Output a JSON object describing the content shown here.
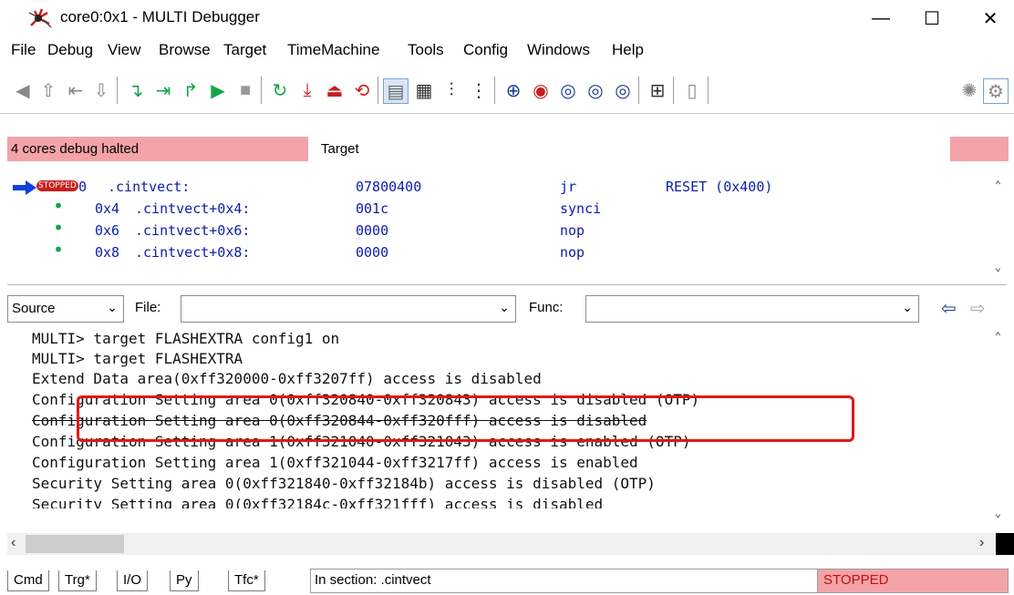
{
  "window": {
    "title": "core0:0x1 - MULTI Debugger",
    "minimize": "—",
    "maximize": "☐",
    "close": "✕"
  },
  "menu": [
    "File",
    "Debug",
    "View",
    "Browse",
    "Target",
    "TimeMachine",
    "Tools",
    "Config",
    "Windows",
    "Help"
  ],
  "status_strip": {
    "cores": "4 cores debug halted",
    "target": "Target"
  },
  "code_lines": [
    {
      "marker": "STOPPED",
      "offset": "0",
      "label": ".cintvect:",
      "hex": "07800400",
      "mnemonic": "jr",
      "operand": "RESET (0x400)"
    },
    {
      "marker": "dot",
      "offset": "0x4",
      "label": ".cintvect+0x4:",
      "hex": "001c",
      "mnemonic": "synci",
      "operand": ""
    },
    {
      "marker": "dot",
      "offset": "0x6",
      "label": ".cintvect+0x6:",
      "hex": "0000",
      "mnemonic": "nop",
      "operand": ""
    },
    {
      "marker": "dot",
      "offset": "0x8",
      "label": ".cintvect+0x8:",
      "hex": "0000",
      "mnemonic": "nop",
      "operand": ""
    }
  ],
  "source_bar": {
    "mode": "Source",
    "file_label": "File:",
    "file_value": "",
    "func_label": "Func:",
    "func_value": ""
  },
  "console_lines": [
    "MULTI> target FLASHEXTRA config1 on",
    "MULTI> target FLASHEXTRA",
    "Extend Data area(0xff320000-0xff3207ff) access is disabled",
    "Configuration Setting area 0(0xff320840-0xff320843) access is disabled (OTP)",
    "Configuration Setting area 0(0xff320844-0xff320fff) access is disabled",
    "Configuration Setting area 1(0xff321040-0xff321043) access is enabled (OTP)",
    "Configuration Setting area 1(0xff321044-0xff3217ff) access is enabled",
    "Security Setting area 0(0xff321840-0xff32184b) access is disabled (OTP)",
    "Security Setting area 0(0xff32184c-0xff321fff) access is disabled"
  ],
  "tabs": [
    "Cmd",
    "Trg*",
    "I/O",
    "Py",
    "Tfc*"
  ],
  "section_info": "In section: .cintvect",
  "run_state": "STOPPED",
  "colors": {
    "halted_bg": "#f4a3a8",
    "code_text": "#0d1da8",
    "highlight": "#e01818",
    "marker_arrow": "#1040e0"
  }
}
